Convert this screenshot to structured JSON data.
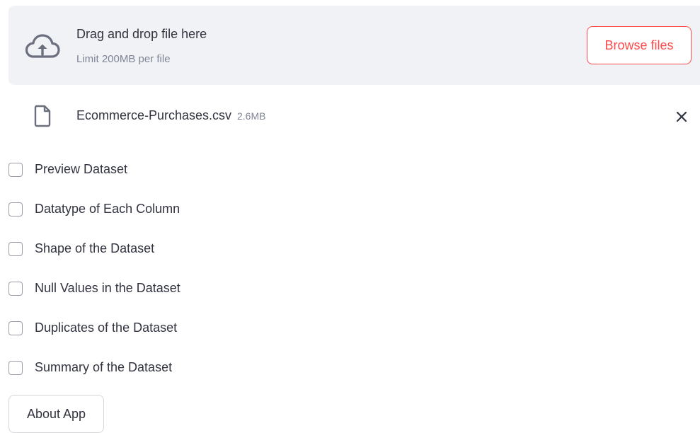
{
  "uploader": {
    "icon": "cloud-upload-icon",
    "title": "Drag and drop file here",
    "subtitle": "Limit 200MB per file",
    "browse_label": "Browse files",
    "accent_color": "#ff4b4b",
    "background_color": "#f0f2f6"
  },
  "uploaded_file": {
    "icon": "file-icon",
    "name": "Ecommerce-Purchases.csv",
    "size": "2.6MB",
    "remove_icon": "close-icon"
  },
  "options": [
    {
      "label": "Preview Dataset",
      "checked": false
    },
    {
      "label": "Datatype of Each Column",
      "checked": false
    },
    {
      "label": "Shape of the Dataset",
      "checked": false
    },
    {
      "label": "Null Values in the Dataset",
      "checked": false
    },
    {
      "label": "Duplicates of the Dataset",
      "checked": false
    },
    {
      "label": "Summary of the Dataset",
      "checked": false
    }
  ],
  "about_button": {
    "label": "About App"
  }
}
